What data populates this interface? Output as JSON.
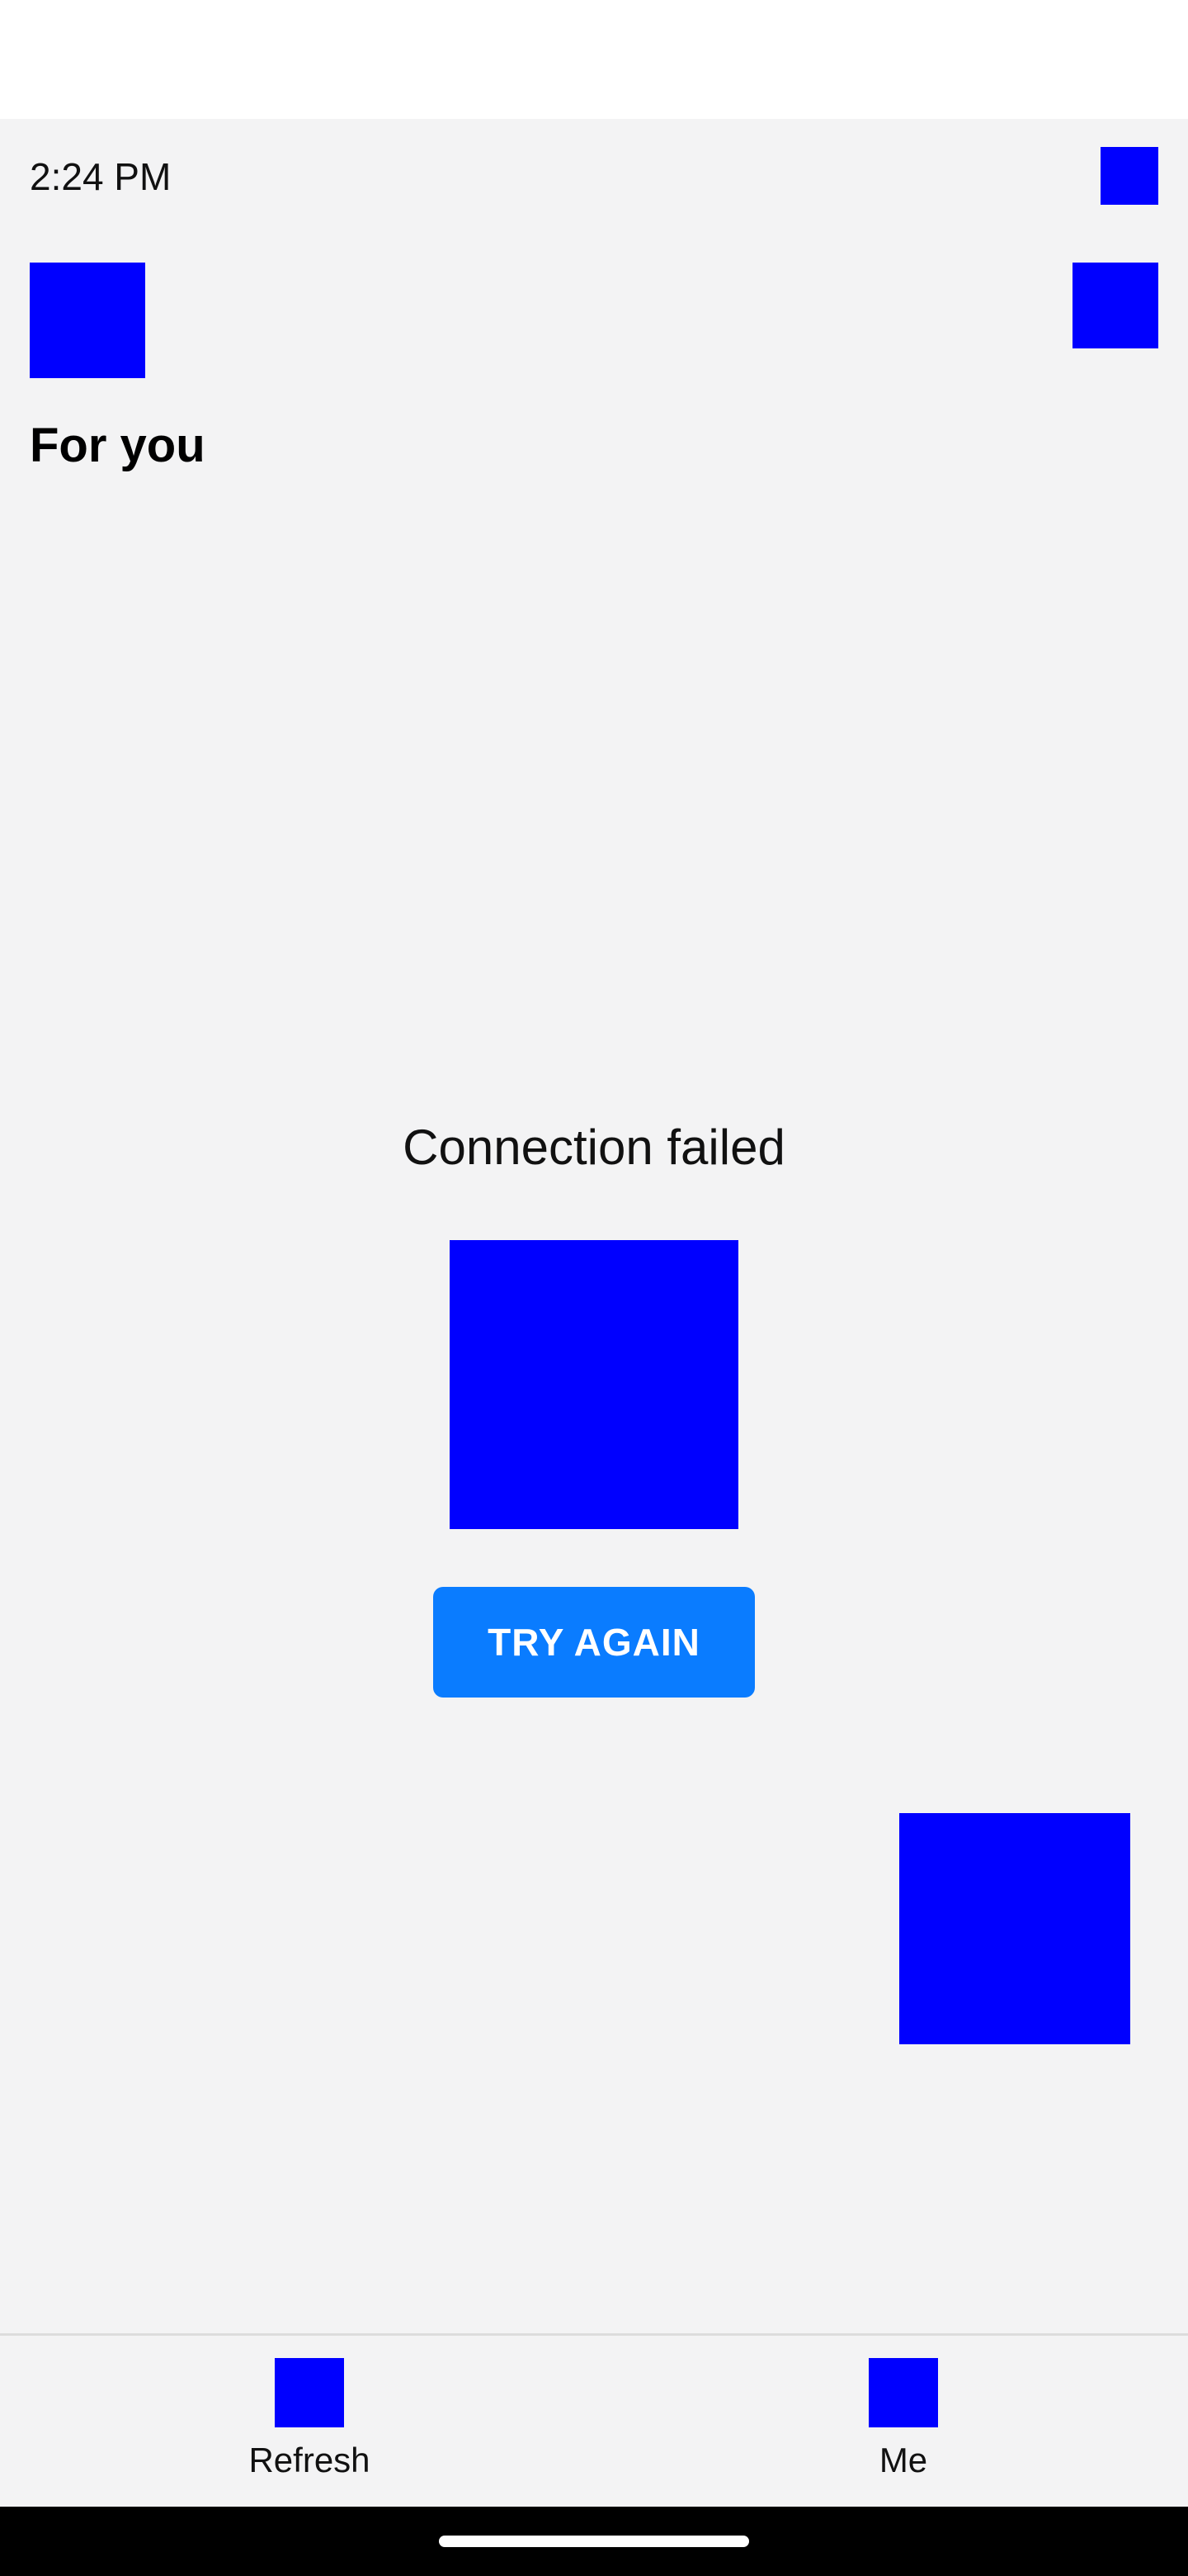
{
  "status_bar": {
    "time": "2:24 PM",
    "status_icon": "status-indicator-icon"
  },
  "header": {
    "menu_icon": "menu-icon",
    "action_icon": "action-icon",
    "title": "For you"
  },
  "main": {
    "error_message": "Connection failed",
    "illustration_icon": "connection-error-illustration",
    "retry_label": "TRY AGAIN",
    "floating_icon": "floating-action-icon"
  },
  "bottom_nav": {
    "items": [
      {
        "label": "Refresh",
        "icon": "refresh-icon"
      },
      {
        "label": "Me",
        "icon": "profile-icon"
      }
    ]
  },
  "colors": {
    "background": "#f3f3f4",
    "accent": "#0a7cff",
    "placeholder": "#0000ff",
    "nav_bar": "#000000"
  }
}
